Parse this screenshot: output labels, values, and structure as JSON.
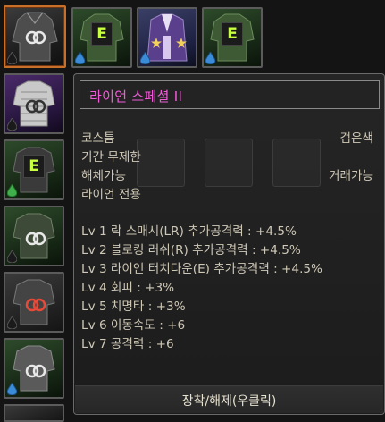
{
  "top_slots": [
    {
      "name": "slot-1",
      "kind": "ring",
      "selected": true
    },
    {
      "name": "slot-2",
      "kind": "e"
    },
    {
      "name": "slot-3",
      "kind": "star"
    },
    {
      "name": "slot-4",
      "kind": "e"
    }
  ],
  "side_slots": [
    {
      "name": "side-slot-1",
      "kind": "ring"
    },
    {
      "name": "side-slot-2",
      "kind": "e"
    },
    {
      "name": "side-slot-3",
      "kind": "ring"
    },
    {
      "name": "side-slot-4",
      "kind": "ring"
    },
    {
      "name": "side-slot-5",
      "kind": "ring-red"
    },
    {
      "name": "side-slot-6",
      "kind": "ring"
    }
  ],
  "tooltip": {
    "title": "라이언 스페셜 II",
    "type": "코스튬",
    "color": "검은색",
    "period": "기간 무제한",
    "disassemble": "해체가능",
    "tradable": "거래가능",
    "exclusive": "라이언 전용",
    "levels": [
      "Lv 1 락 스매시(LR) 추가공격력 : +4.5%",
      "Lv 2 블로킹 러쉬(R) 추가공격력 : +4.5%",
      "Lv 3 라이언 터치다운(E) 추가공격력 : +4.5%",
      "Lv 4 회피 : +3%",
      "Lv 5 치명타 : +3%",
      "Lv 6 이동속도 : +6",
      "Lv 7 공격력 : +6"
    ],
    "footer": "장착/해제(우클릭)"
  },
  "colors": {
    "title": "#f25bd8",
    "text": "#cfc8b6",
    "selected_border": "#c8702a",
    "e_badge": "#c8ff40"
  },
  "icons": [
    "dual-ring-icon",
    "e-badge-icon",
    "droplet-icon",
    "star-icon"
  ]
}
